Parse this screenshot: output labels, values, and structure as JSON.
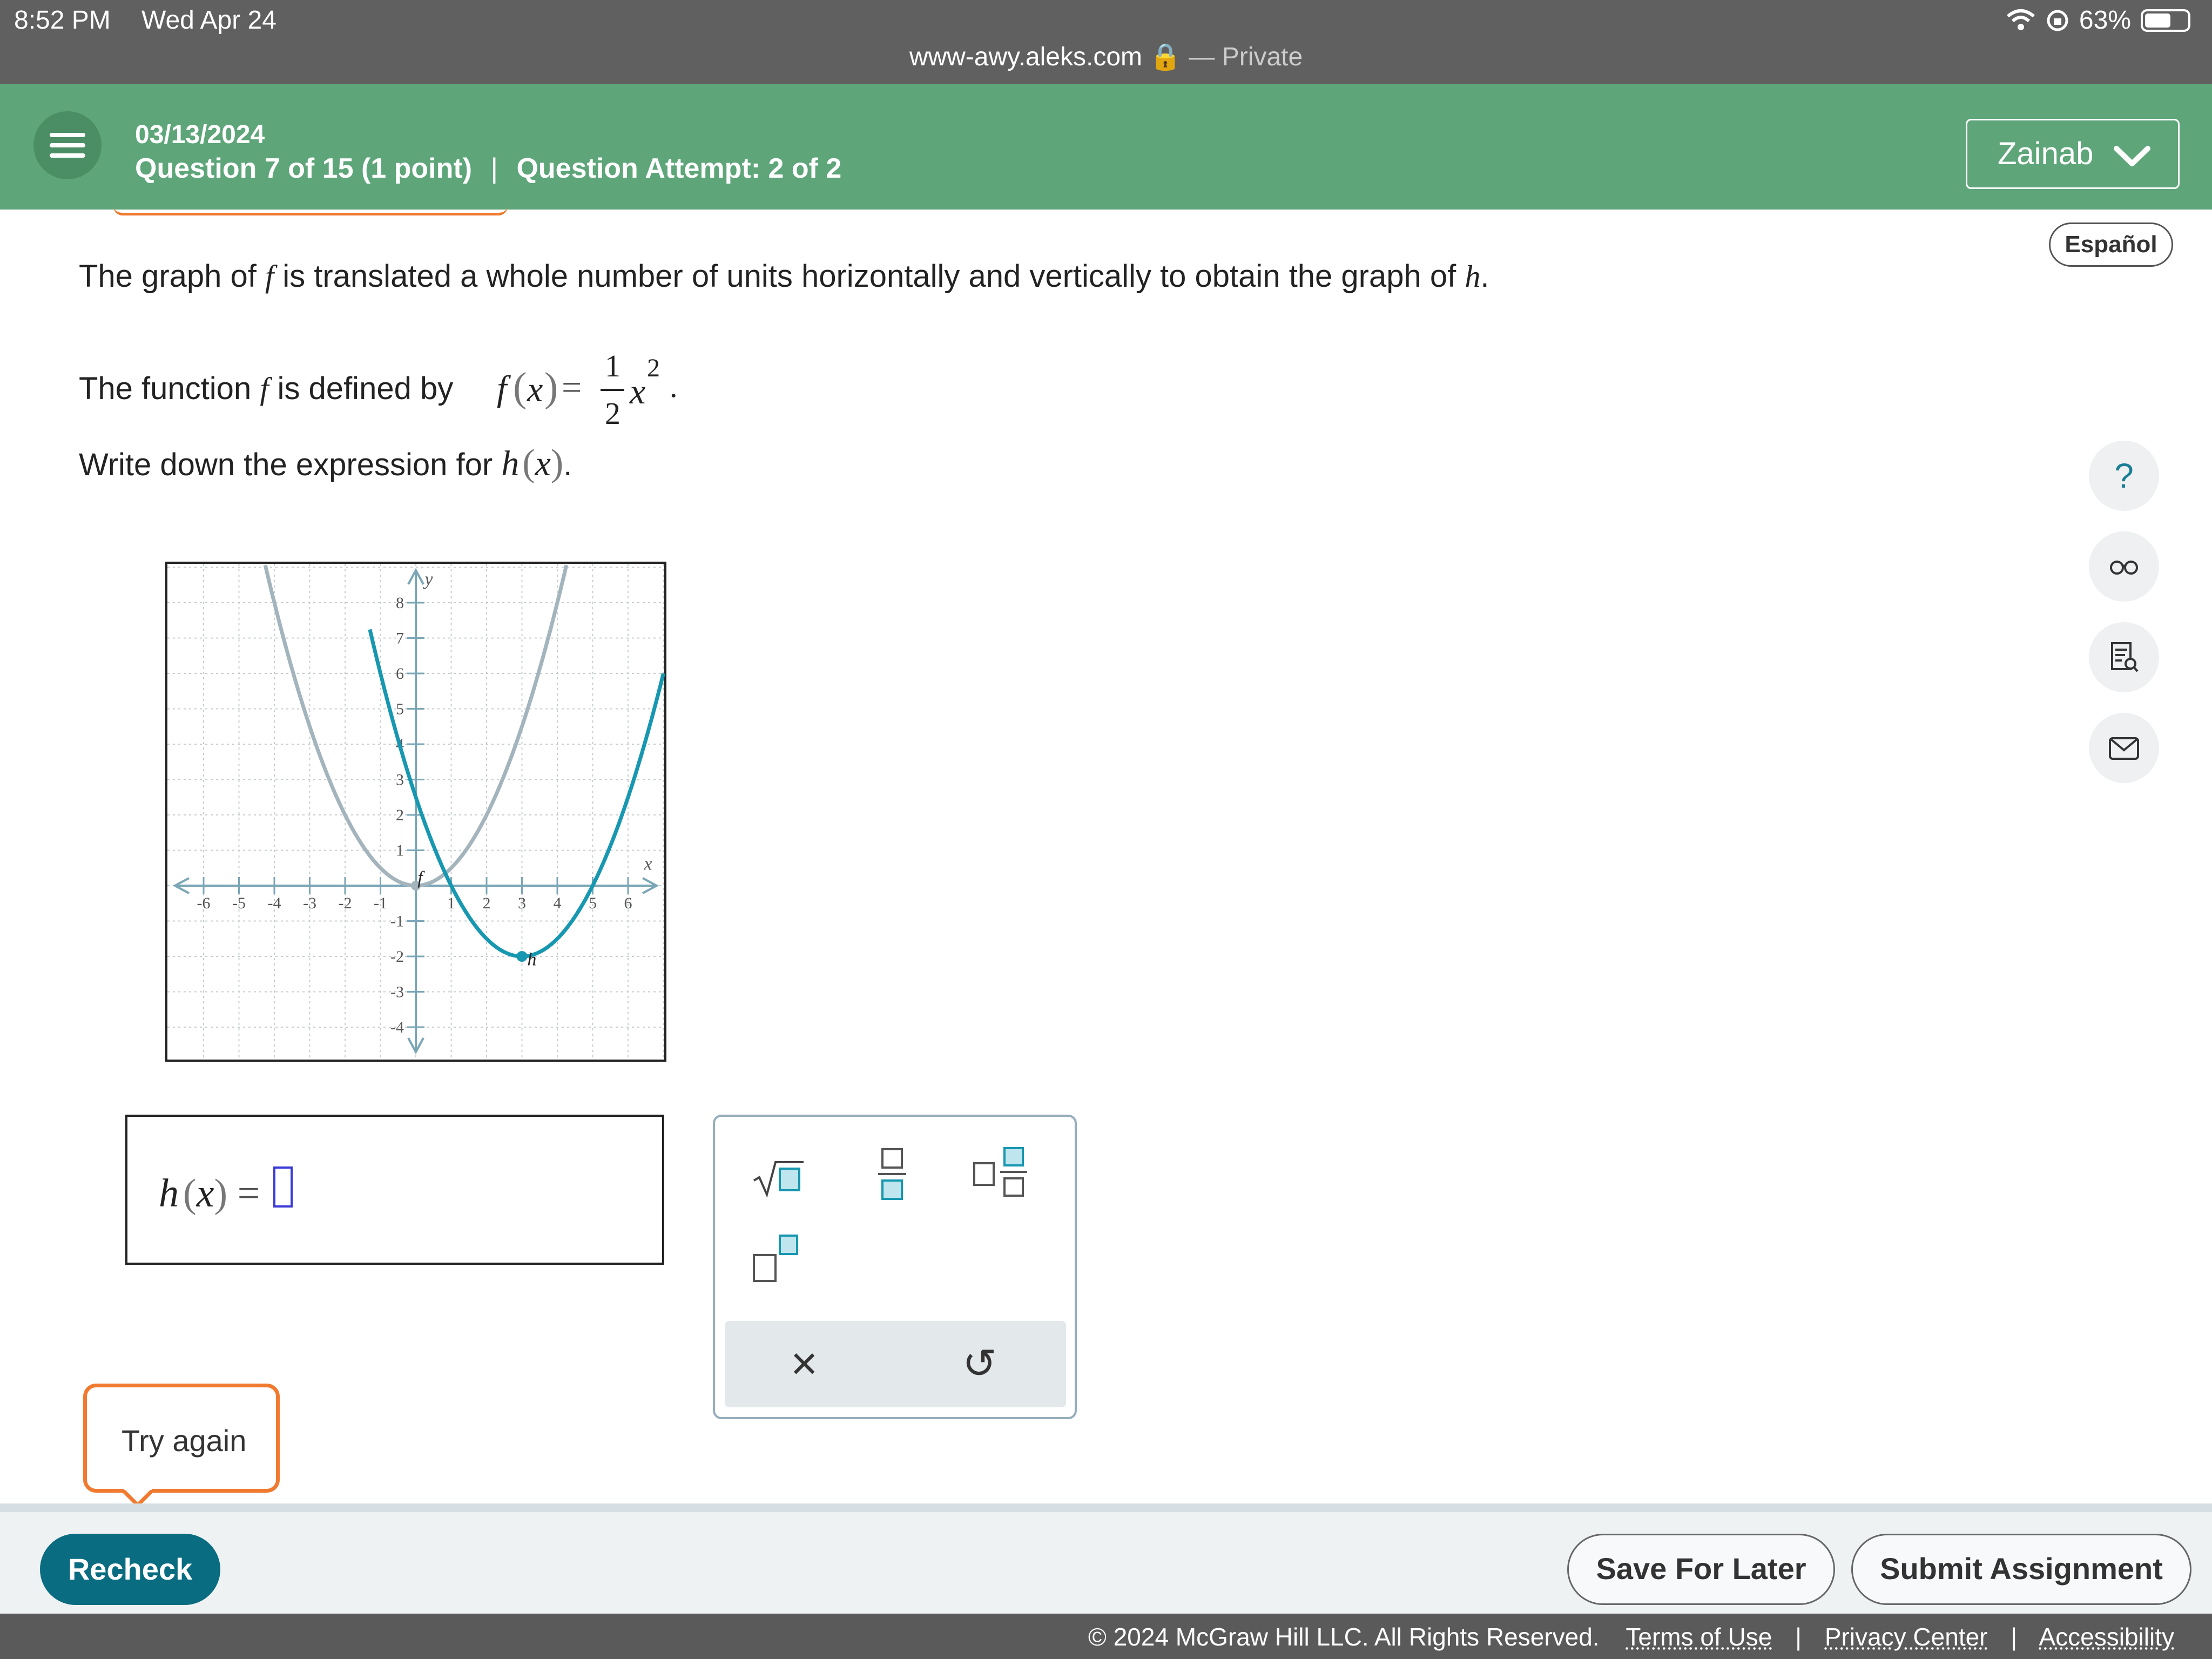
{
  "status_bar": {
    "time": "8:52 PM",
    "date": "Wed Apr 24",
    "battery": "63%"
  },
  "browser": {
    "url": "www-awy.aleks.com",
    "mode": "— Private"
  },
  "header": {
    "date": "03/13/2024",
    "question": "Question 7 of 15 (1 point)",
    "separator": "|",
    "attempt": "Question Attempt: 2 of 2",
    "user": "Zainab"
  },
  "language_button": "Español",
  "problem": {
    "line1_a": "The graph of ",
    "line1_f": "f",
    "line1_b": " is translated a whole number of units horizontally and vertically to obtain the graph of ",
    "line1_h": "h",
    "line1_end": ".",
    "line2_a": "The function ",
    "line2_f": "f",
    "line2_b": " is defined by ",
    "formula_f": "f",
    "formula_x": "x",
    "formula_eq": "=",
    "formula_num": "1",
    "formula_den": "2",
    "formula_var": "x",
    "formula_exp": "2",
    "line2_end": ".",
    "line3_a": "Write down the expression for ",
    "line3_h": "h",
    "line3_x": "x",
    "line3_end": "."
  },
  "graph": {
    "x_label": "x",
    "y_label": "y",
    "x_ticks": [
      "-6",
      "-5",
      "-4",
      "-3",
      "-2",
      "-1",
      "1",
      "2",
      "3",
      "4",
      "5",
      "6"
    ],
    "y_ticks": [
      "8",
      "7",
      "6",
      "5",
      "4",
      "3",
      "2",
      "1",
      "-1",
      "-2",
      "-3",
      "-4"
    ],
    "curve_f_label": "f",
    "curve_h_label": "h",
    "f_color": "#a4b4bc",
    "h_color": "#1797b0"
  },
  "answer": {
    "lhs_h": "h",
    "lhs_x": "x",
    "equals": "="
  },
  "keypad": {
    "clear": "×",
    "undo": "↺"
  },
  "feedback": "Try again",
  "footer": {
    "recheck": "Recheck",
    "save": "Save For Later",
    "submit": "Submit Assignment",
    "copyright": "© 2024 McGraw Hill LLC. All Rights Reserved.",
    "terms": "Terms of Use",
    "privacy": "Privacy Center",
    "accessibility": "Accessibility",
    "sep": "|"
  },
  "colors": {
    "header_green": "#5ea67a",
    "accent_teal": "#0a6c80",
    "alert_orange": "#f07b30"
  }
}
